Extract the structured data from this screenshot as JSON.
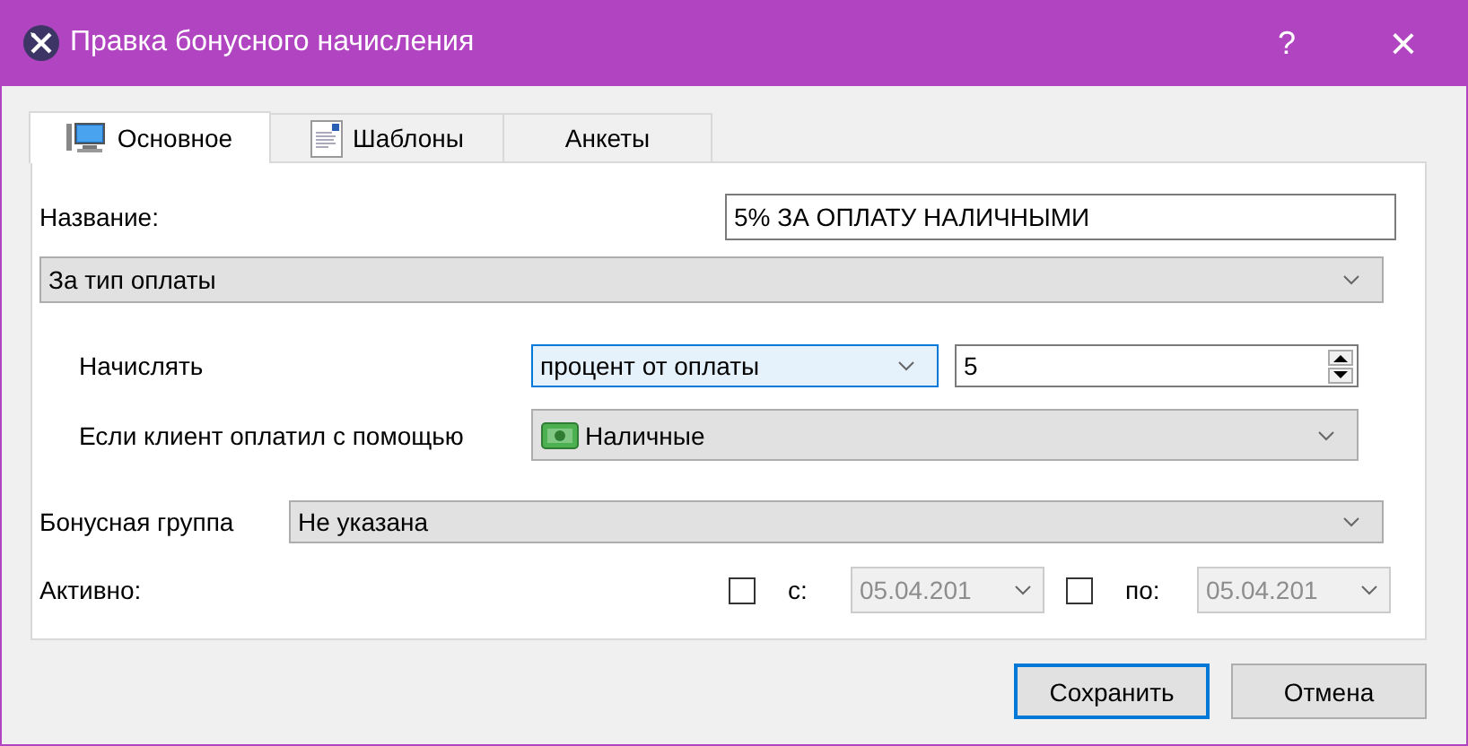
{
  "window": {
    "title": "Правка бонусного начисления",
    "help": "?",
    "close": "×"
  },
  "tabs": [
    {
      "label": "Основное",
      "selected": true,
      "kind": "monitor"
    },
    {
      "label": "Шаблоны",
      "selected": false,
      "kind": "document"
    },
    {
      "label": "Анкеты",
      "selected": false,
      "kind": "none"
    }
  ],
  "form": {
    "name_label": "Название:",
    "name_value": "5% ЗА ОПЛАТУ НАЛИЧНЫМИ",
    "type_value": "За тип оплаты",
    "accrue_label": "Начислять",
    "accrue_value": "процент от оплаты",
    "accrue_focused": true,
    "amount_value": "5",
    "payment_label": "Если клиент оплатил с помощью",
    "payment_value": "Наличные",
    "group_label": "Бонусная группа",
    "group_value": "Не указана",
    "active_label": "Активно:",
    "period": [
      {
        "label": "с:",
        "checked": false,
        "date": "05.04.201",
        "disabled": true
      },
      {
        "label": "по:",
        "checked": false,
        "date": "05.04.201",
        "disabled": true
      }
    ]
  },
  "buttons": [
    {
      "label": "Сохранить",
      "default": true
    },
    {
      "label": "Отмена",
      "default": false
    }
  ]
}
